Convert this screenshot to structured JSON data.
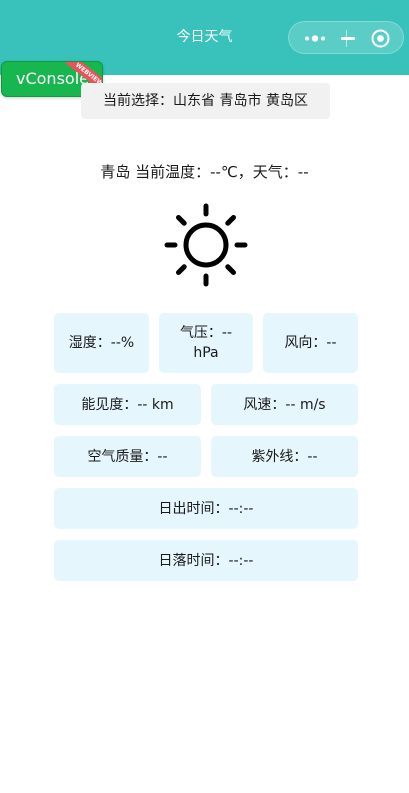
{
  "navbar": {
    "title": "今日天气",
    "background": "#38c2bb",
    "capsule": {
      "more_icon": "more-dots-icon",
      "minimize_icon": "minimize-icon",
      "close_icon": "close-target-icon"
    }
  },
  "vconsole": {
    "label": "vConsole",
    "ribbon": "WEBVIEW",
    "color": "#17b64f"
  },
  "location": {
    "text": "当前选择：山东省 青岛市 黄岛区"
  },
  "summary": {
    "text": "青岛 当前温度：--℃，天气：--"
  },
  "weather_icon": "sun-icon",
  "cards": {
    "humidity": "湿度：--%",
    "pressure_line1": "气压：--",
    "pressure_line2": "hPa",
    "wind_direction": "风向：--",
    "visibility": "能见度：-- km",
    "wind_speed": "风速：-- m/s",
    "air_quality": "空气质量：--",
    "uv": "紫外线：--",
    "sunrise": "日出时间：--:--",
    "sunset": "日落时间：--:--",
    "card_color": "#e6f6fd"
  }
}
